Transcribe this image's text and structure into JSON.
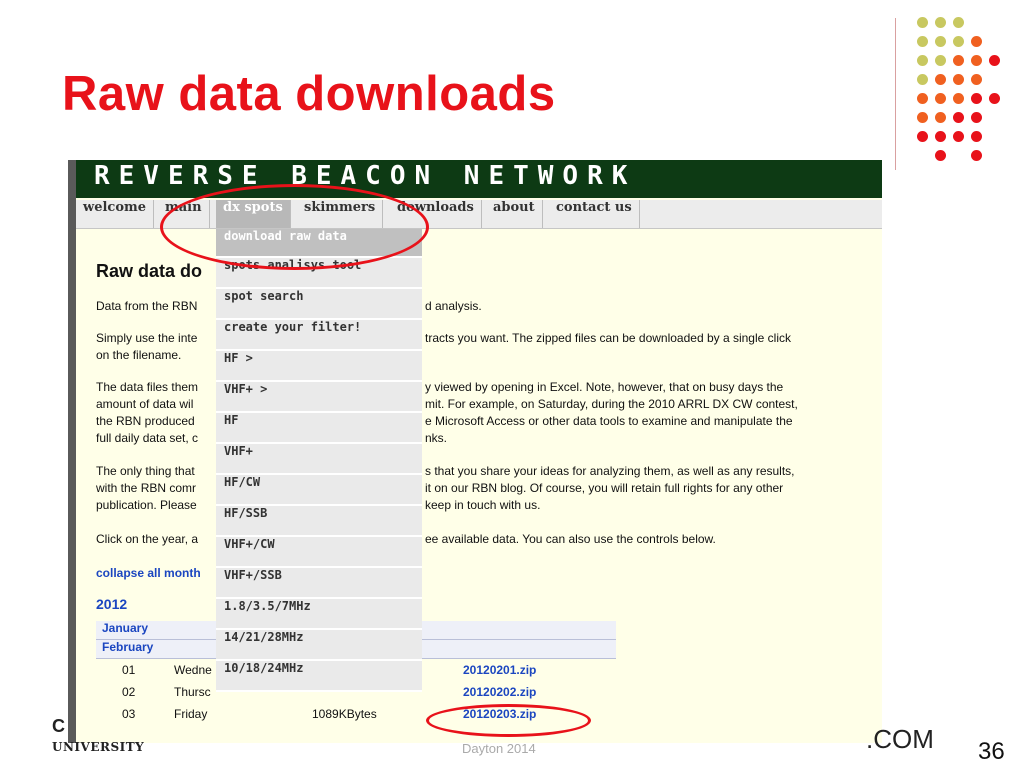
{
  "slide": {
    "title": "Raw data downloads",
    "page_number": "36",
    "footer_left_top": "C",
    "footer_left_bottom": "UNIVERSITY",
    "footer_center": "Dayton 2014",
    "footer_right": ".COM"
  },
  "website": {
    "banner": "REVERSE BEACON NETWORK",
    "nav": [
      "welcome",
      "main",
      "dx spots",
      "skimmers",
      "downloads",
      "about",
      "contact us"
    ],
    "dropdown": [
      "download raw data",
      "spots analisys tool",
      "spot search",
      "create your filter!",
      "HF >",
      "VHF+ >",
      "HF",
      "VHF+",
      "HF/CW",
      "HF/SSB",
      "VHF+/CW",
      "VHF+/SSB",
      "1.8/3.5/7MHz",
      "14/21/28MHz",
      "10/18/24MHz"
    ],
    "page": {
      "heading_visible": "Raw data do",
      "p1_left": "Data from the RBN",
      "p1_right": "d analysis.",
      "p2_left": [
        "Simply use the inte",
        "on the filename."
      ],
      "p2_right": "tracts you want. The zipped files can be downloaded by a single click",
      "p3_left": [
        "The data files them",
        "amount of data wil",
        "the RBN produced",
        "full daily data set, c"
      ],
      "p3_right": [
        "y viewed by opening in Excel. Note, however, that on busy days the",
        "mit. For example, on Saturday, during the 2010 ARRL DX CW contest,",
        "e Microsoft Access or other data tools to examine and manipulate the",
        "nks."
      ],
      "p4_left": [
        "The only thing that",
        "with the RBN comr",
        "publication. Please"
      ],
      "p4_right": [
        "s that you share your ideas for analyzing them, as well as any results,",
        "it on our RBN blog. Of course, you will retain full rights for any other",
        "keep in touch with us."
      ],
      "p5_left": "Click on the year, a",
      "p5_right": "ee available data. You can also use the controls below.",
      "collapse_link": "collapse all month",
      "year": "2012",
      "months": [
        "January",
        "February"
      ],
      "rows": [
        {
          "day": "01",
          "weekday": "Wedne",
          "size": "",
          "file": "20120201.zip"
        },
        {
          "day": "02",
          "weekday": "Thursc",
          "size": "",
          "file": "20120202.zip"
        },
        {
          "day": "03",
          "weekday": "Friday",
          "size": "1089KBytes",
          "file": "20120203.zip"
        }
      ]
    }
  },
  "colors": {
    "title_red": "#e8121a",
    "banner_green": "#0d3a14",
    "link_blue": "#1b46c0",
    "dot_olive": "#c8c860",
    "dot_orange": "#f06020",
    "dot_red": "#e8121a"
  }
}
